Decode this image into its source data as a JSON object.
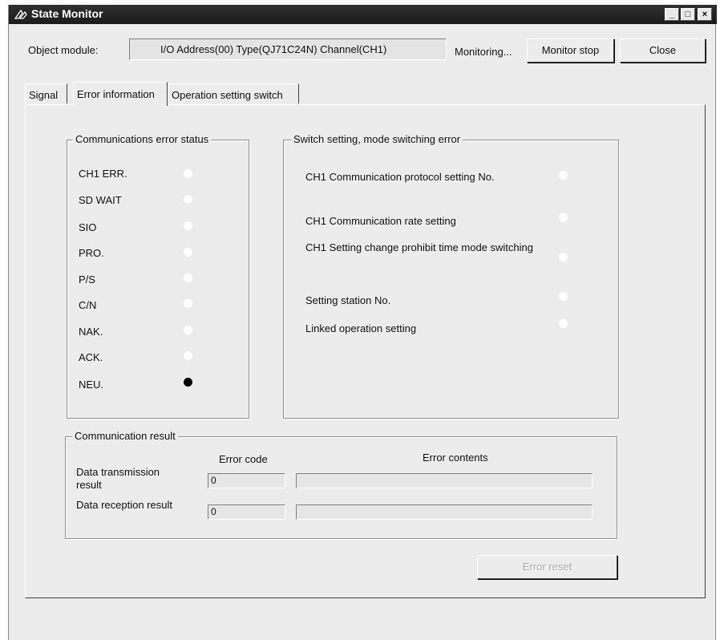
{
  "window": {
    "title": "State Monitor"
  },
  "header": {
    "object_module_label": "Object module:",
    "object_module_value": "I/O Address(00) Type(QJ71C24N) Channel(CH1)",
    "status_text": "Monitoring...",
    "monitor_stop_label": "Monitor stop",
    "close_label": "Close"
  },
  "tabs": [
    {
      "label": "Signal",
      "active": false
    },
    {
      "label": "Error information",
      "active": true
    },
    {
      "label": "Operation setting switch",
      "active": false
    }
  ],
  "comm_error_status": {
    "title": "Communications error status",
    "items": [
      {
        "label": "CH1 ERR.",
        "on": false
      },
      {
        "label": "SD WAIT",
        "on": false
      },
      {
        "label": "SIO",
        "on": false
      },
      {
        "label": "PRO.",
        "on": false
      },
      {
        "label": "P/S",
        "on": false
      },
      {
        "label": "C/N",
        "on": false
      },
      {
        "label": "NAK.",
        "on": false
      },
      {
        "label": "ACK.",
        "on": false
      },
      {
        "label": "NEU.",
        "on": true
      }
    ]
  },
  "switch_error": {
    "title": "Switch setting, mode switching error",
    "items": [
      {
        "label": "CH1 Communication protocol setting No.",
        "on": false
      },
      {
        "label": "CH1 Communication rate setting",
        "on": false
      },
      {
        "label": "CH1 Setting change prohibit time mode switching",
        "on": false
      },
      {
        "label": "Setting station No.",
        "on": false
      },
      {
        "label": "Linked operation setting",
        "on": false
      }
    ]
  },
  "comm_result": {
    "title": "Communication result",
    "error_code_header": "Error code",
    "error_contents_header": "Error contents",
    "rows": [
      {
        "label": "Data transmission result",
        "error_code": "0",
        "error_contents": ""
      },
      {
        "label": "Data reception result",
        "error_code": "0",
        "error_contents": ""
      }
    ]
  },
  "error_reset_label": "Error reset",
  "colors": {
    "titlebar": "#1b1b1b",
    "led_off": "#ffffff",
    "led_on": "#000000",
    "face": "#ececec"
  },
  "icons": [
    "app-icon",
    "minimize-icon",
    "maximize-icon",
    "close-window-icon"
  ]
}
